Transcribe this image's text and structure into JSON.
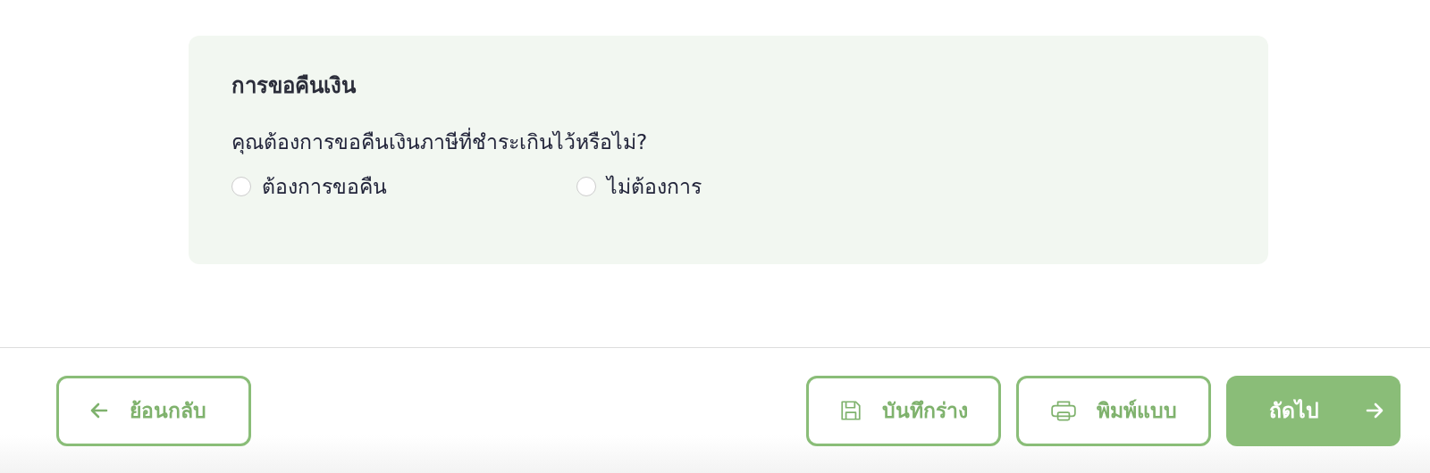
{
  "section": {
    "title": "การขอคืนเงิน",
    "question": "คุณต้องการขอคืนเงินภาษีที่ชำระเกินไว้หรือไม่?",
    "options": [
      {
        "label": "ต้องการขอคืน",
        "selected": false
      },
      {
        "label": "ไม่ต้องการ",
        "selected": false
      }
    ]
  },
  "footer": {
    "back_button": {
      "label": "ย้อนกลับ"
    },
    "save_button": {
      "label": "บันทึกร่าง"
    },
    "print_button": {
      "label": "พิมพ์แบบ"
    },
    "next_button": {
      "label": "ถัดไป"
    }
  }
}
